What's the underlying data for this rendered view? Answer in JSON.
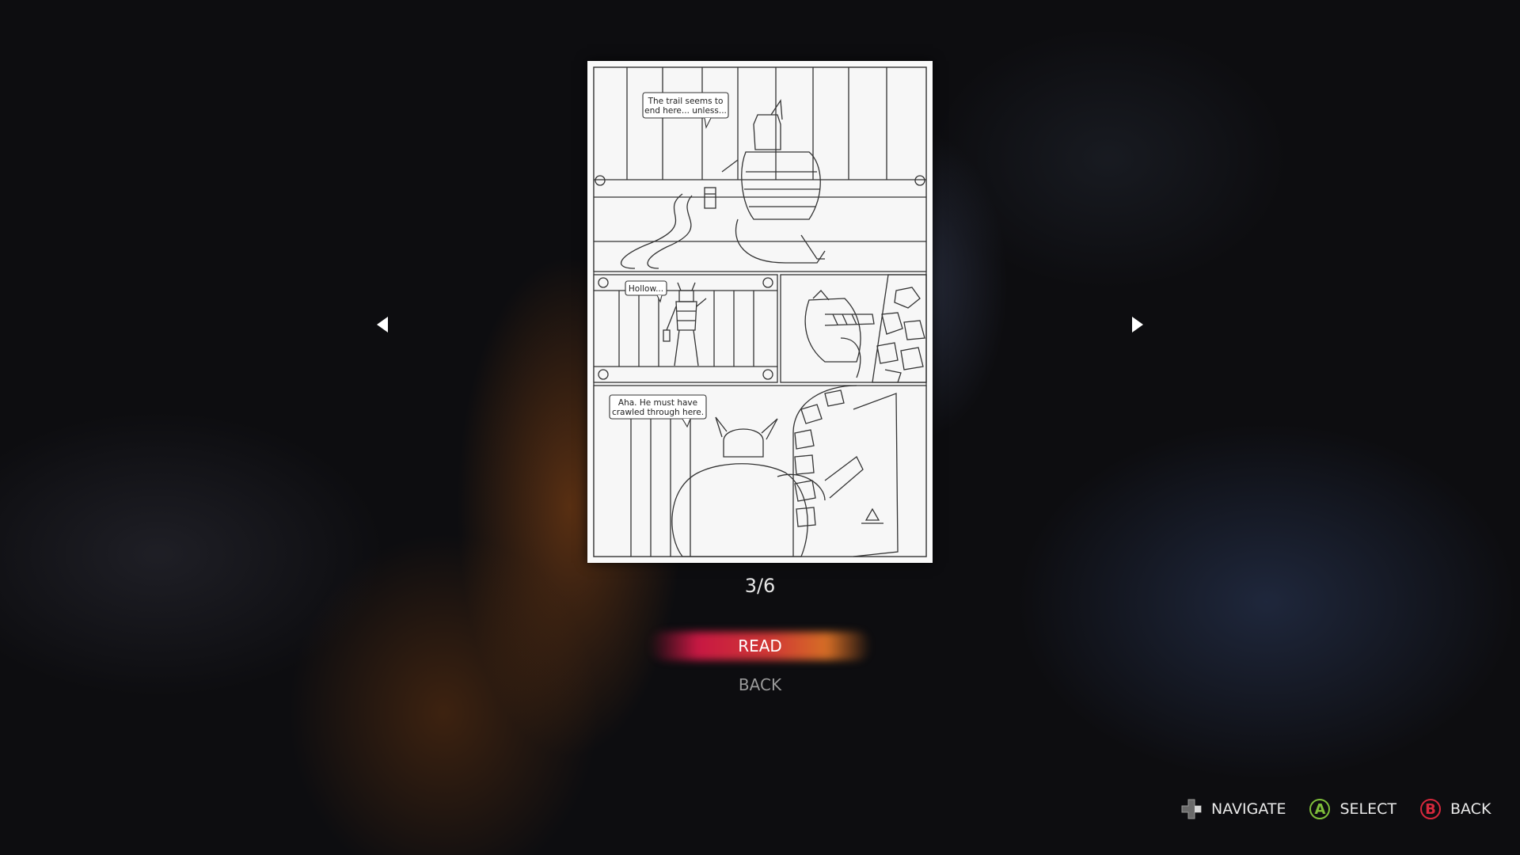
{
  "comic": {
    "page_counter": "3/6",
    "panels": {
      "panel1_speech": [
        "The trail seems to",
        "end here... unless..."
      ],
      "panel2_speech": [
        "Hollow..."
      ],
      "panel4_speech": [
        "Aha. He must have",
        "crawled through here."
      ]
    }
  },
  "menu": {
    "read_label": "READ",
    "back_label": "BACK"
  },
  "controller_hints": {
    "navigate": {
      "icon": "dpad-icon",
      "label": "NAVIGATE"
    },
    "select": {
      "icon": "a-button-icon",
      "glyph": "A",
      "label": "SELECT",
      "color": "#7fbf3a"
    },
    "back": {
      "icon": "b-button-icon",
      "glyph": "B",
      "label": "BACK",
      "color": "#d6283c"
    }
  },
  "colors": {
    "selected_highlight_start": "#d21946",
    "selected_highlight_end": "#f08c28"
  }
}
